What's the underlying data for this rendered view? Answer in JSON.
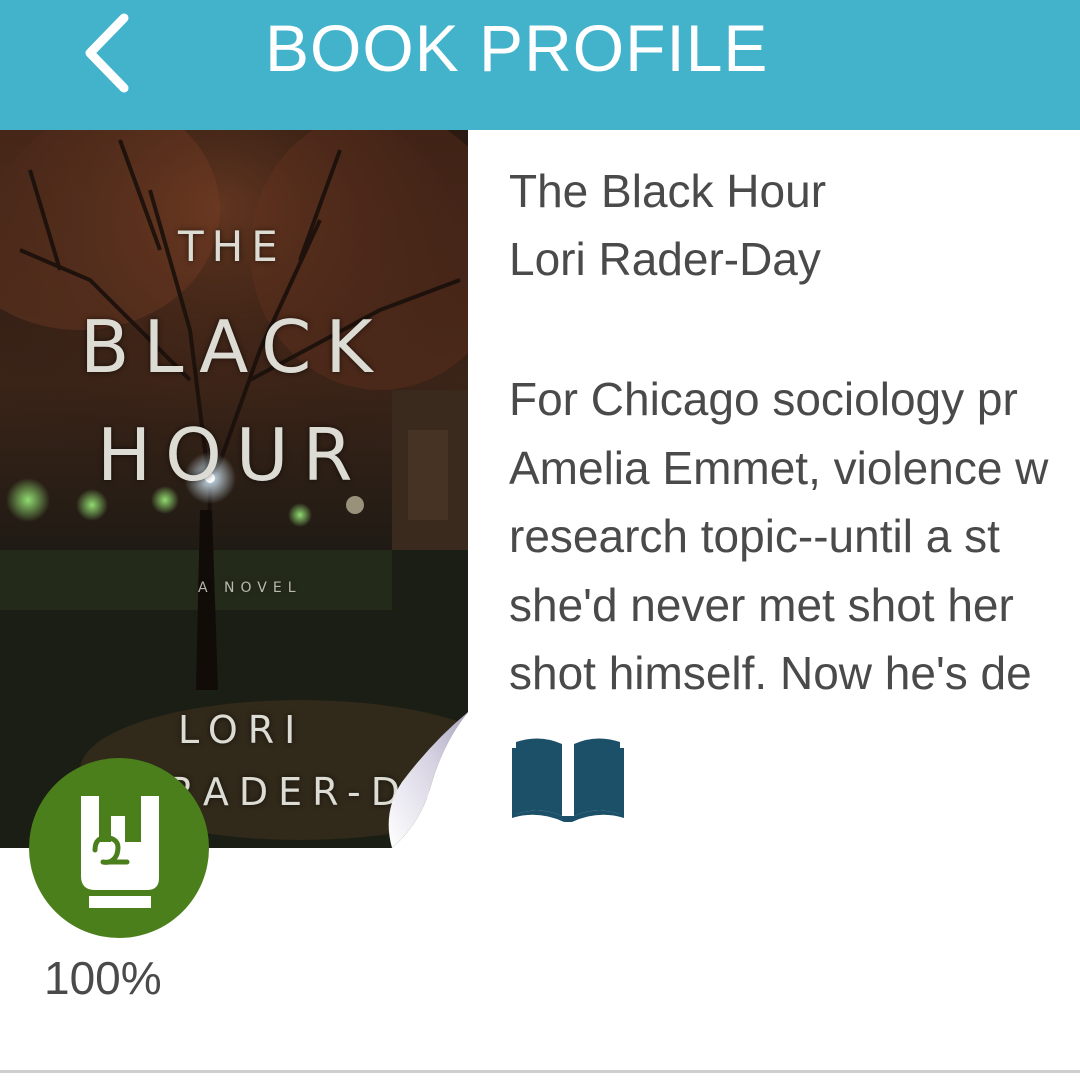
{
  "header": {
    "title": "BOOK PROFILE",
    "back_icon": "chevron-left-icon",
    "background_color": "#43b3cc"
  },
  "cover": {
    "line_the": "THE",
    "line_black": "BLACK",
    "line_hour": "HOUR",
    "line_novel": "A NOVEL",
    "line_author_first": "LORI",
    "line_author_last": "RADER-DAY"
  },
  "book": {
    "title": "The Black Hour",
    "author": "Lori Rader-Day",
    "description_lines": [
      "For Chicago sociology pr",
      "Amelia Emmet, violence w",
      "research topic--until a st",
      "she'd never met shot her",
      "shot himself. Now he's de"
    ]
  },
  "rating": {
    "percent": "100%",
    "value": 1.0,
    "icon": "rock-hand-icon",
    "color": "#4b7f1c"
  },
  "actions": {
    "read_icon": "open-book-icon",
    "read_icon_color": "#1c5068"
  }
}
